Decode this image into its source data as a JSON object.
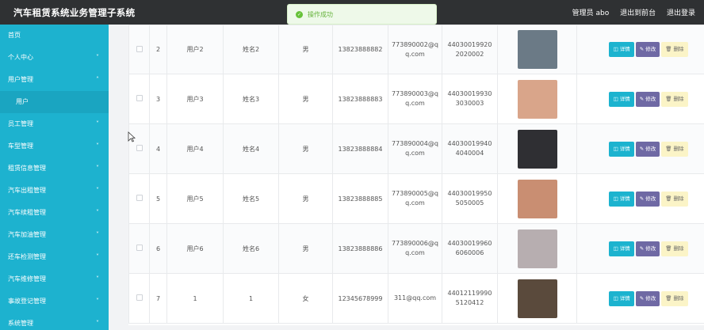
{
  "app": {
    "title": "汽车租赁系统业务管理子系统",
    "admin": "管理员 abo",
    "to_front": "退出到前台",
    "logout": "退出登录"
  },
  "toast": {
    "message": "操作成功",
    "color": "#67c23a"
  },
  "sidebar": {
    "items": [
      {
        "label": "首页",
        "chevron": false
      },
      {
        "label": "个人中心",
        "chevron": true,
        "dir": "down"
      },
      {
        "label": "用户管理",
        "chevron": true,
        "dir": "up"
      },
      {
        "label": "用户",
        "chevron": false,
        "sub": true
      },
      {
        "label": "员工管理",
        "chevron": true,
        "dir": "down"
      },
      {
        "label": "车型管理",
        "chevron": true,
        "dir": "down"
      },
      {
        "label": "租赁信息管理",
        "chevron": true,
        "dir": "down"
      },
      {
        "label": "汽车出租管理",
        "chevron": true,
        "dir": "down"
      },
      {
        "label": "汽车续租管理",
        "chevron": true,
        "dir": "down"
      },
      {
        "label": "汽车加油管理",
        "chevron": true,
        "dir": "down"
      },
      {
        "label": "还车检测管理",
        "chevron": true,
        "dir": "down"
      },
      {
        "label": "汽车维修管理",
        "chevron": true,
        "dir": "down"
      },
      {
        "label": "事故登记管理",
        "chevron": true,
        "dir": "down"
      },
      {
        "label": "系统管理",
        "chevron": true,
        "dir": "down"
      }
    ]
  },
  "buttons": {
    "detail": "详情",
    "edit": "修改",
    "delete": "删除"
  },
  "table": {
    "rows": [
      {
        "no": "2",
        "account": "用户2",
        "name": "姓名2",
        "gender": "男",
        "phone": "13823888882",
        "email": "773890002@qq.com",
        "idcard": "440300199202020002",
        "avatar": "#6b7a86"
      },
      {
        "no": "3",
        "account": "用户3",
        "name": "姓名3",
        "gender": "男",
        "phone": "13823888883",
        "email": "773890003@qq.com",
        "idcard": "440300199303030003",
        "avatar": "#d9a58a"
      },
      {
        "no": "4",
        "account": "用户4",
        "name": "姓名4",
        "gender": "男",
        "phone": "13823888884",
        "email": "773890004@qq.com",
        "idcard": "440300199404040004",
        "avatar": "#2f2f33"
      },
      {
        "no": "5",
        "account": "用户5",
        "name": "姓名5",
        "gender": "男",
        "phone": "13823888885",
        "email": "773890005@qq.com",
        "idcard": "440300199505050005",
        "avatar": "#c98e72"
      },
      {
        "no": "6",
        "account": "用户6",
        "name": "姓名6",
        "gender": "男",
        "phone": "13823888886",
        "email": "773890006@qq.com",
        "idcard": "440300199606060006",
        "avatar": "#b7aeb0"
      },
      {
        "no": "7",
        "account": "1",
        "name": "1",
        "gender": "女",
        "phone": "12345678999",
        "email": "311@qq.com",
        "idcard": "440121199905120412",
        "avatar": "#5a4a3c"
      }
    ]
  }
}
